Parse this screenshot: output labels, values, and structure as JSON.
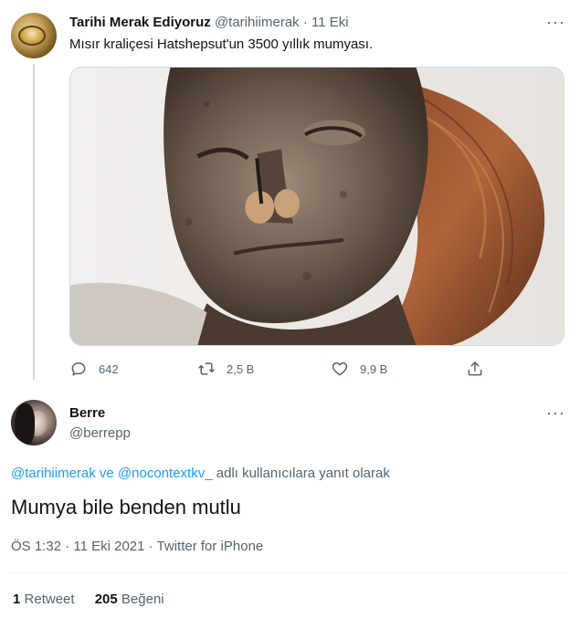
{
  "parent": {
    "name": "Tarihi Merak Ediyoruz",
    "handle": "@tarihiimerak",
    "separator": "·",
    "date": "11 Eki",
    "more": "···",
    "text": "Mısır kraliçesi Hatshepsut'un 3500 yıllık mumyası.",
    "actions": {
      "replies": "642",
      "retweets": "2,5 B",
      "likes": "9,9 B"
    }
  },
  "reply": {
    "name": "Berre",
    "handle": "@berrepp",
    "more": "···",
    "replying_to": {
      "mention1": "@tarihiimerak",
      "joiner": "ve",
      "mention2": "@nocontextkv_",
      "suffix": "adlı kullanıcılara yanıt olarak"
    },
    "text": "Mumya bile benden mutlu",
    "meta": "ÖS 1:32 · 11 Eki 2021 · Twitter for iPhone",
    "stats": {
      "retweet_count": "1",
      "retweet_label": "Retweet",
      "like_count": "205",
      "like_label": "Beğeni"
    }
  },
  "colors": {
    "accent": "#1d9bf0",
    "secondary_text": "#536471",
    "primary_text": "#0f1419"
  },
  "icons": [
    "more-icon",
    "reply-icon",
    "retweet-icon",
    "like-icon",
    "share-icon"
  ]
}
